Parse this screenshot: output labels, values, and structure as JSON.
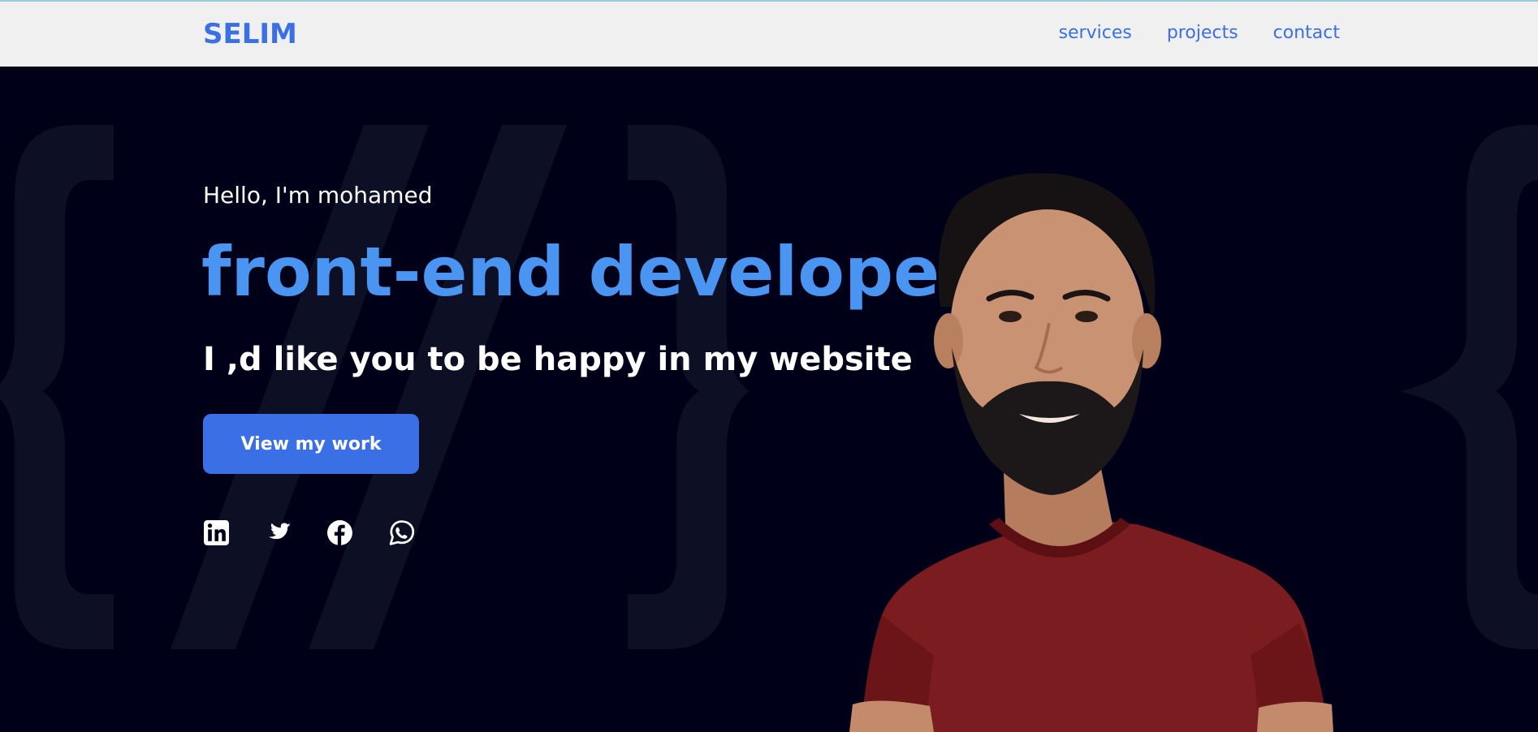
{
  "navbar": {
    "brand": "SELIM",
    "links": [
      "services",
      "projects",
      "contact"
    ]
  },
  "hero": {
    "greeting": "Hello, I'm mohamed",
    "role": "front-end developer",
    "tagline": "I ,d like you to be happy in my website",
    "cta_label": "View my work",
    "socials": [
      "linkedin-icon",
      "twitter-icon",
      "facebook-icon",
      "whatsapp-icon"
    ]
  },
  "colors": {
    "accent": "#3b6fe6",
    "role_text": "#4a95f2",
    "hero_bg": "#000119",
    "navbar_bg": "#f0f0f0"
  }
}
